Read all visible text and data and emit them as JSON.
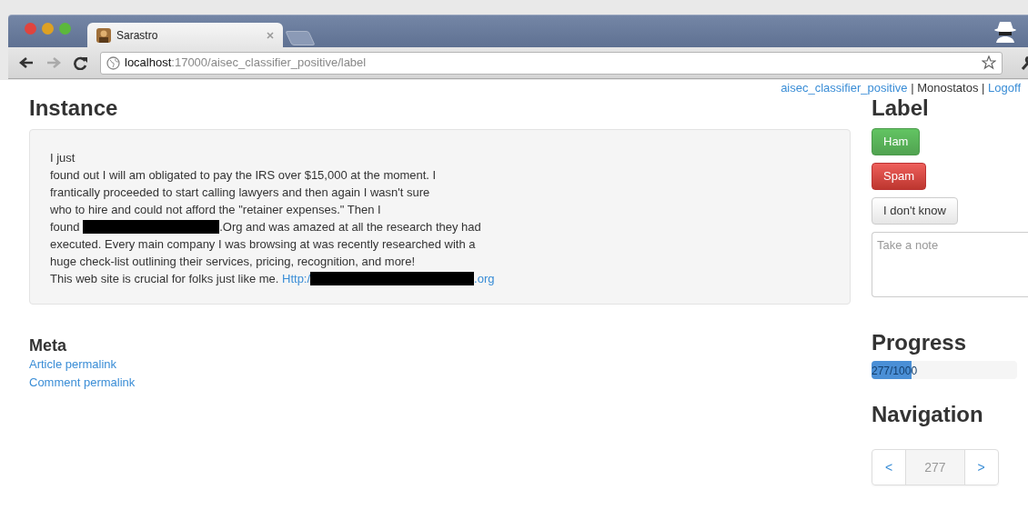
{
  "browser": {
    "tab": {
      "title": "Sarastro",
      "selected": true
    },
    "url": {
      "host": "localhost",
      "rest": ":17000/aisec_classifier_positive/label"
    }
  },
  "user_bar": [
    {
      "kind": "link",
      "text": "aisec_classifier_positive"
    },
    {
      "kind": "sep",
      "text": "|"
    },
    {
      "kind": "text",
      "text": "Monostatos"
    },
    {
      "kind": "sep",
      "text": "|"
    },
    {
      "kind": "link",
      "text": "Logoff"
    }
  ],
  "instance": {
    "heading": "Instance",
    "lines": [
      [
        {
          "kind": "text",
          "text": "I just"
        }
      ],
      [
        {
          "kind": "text",
          "text": "found out I will am obligated to pay the IRS over $15,000 at the moment. I"
        }
      ],
      [
        {
          "kind": "text",
          "text": "frantically proceeded to start calling lawyers and then again I wasn't sure"
        }
      ],
      [
        {
          "kind": "text",
          "text": "who to hire and could not afford the \"retainer expenses.\" Then I"
        }
      ],
      [
        {
          "kind": "text",
          "text": "found "
        },
        {
          "kind": "redacted"
        },
        {
          "kind": "text",
          "text": ".Org and was amazed at all the research they had"
        }
      ],
      [
        {
          "kind": "text",
          "text": "executed. Every main company I was browsing at was recently researched with a"
        }
      ],
      [
        {
          "kind": "text",
          "text": "huge check-list outlining their services, pricing, recognition, and more!"
        }
      ],
      [
        {
          "kind": "text",
          "text": "This web site is crucial for folks just like me. "
        },
        {
          "kind": "link",
          "text": "Http:/"
        },
        {
          "kind": "redacted-link"
        },
        {
          "kind": "link",
          "text": ".org"
        }
      ]
    ]
  },
  "meta": {
    "heading": "Meta",
    "links": [
      "Article permalink",
      "Comment permalink"
    ]
  },
  "label": {
    "heading": "Label",
    "buttons": [
      {
        "kind": "success",
        "text": "Ham"
      },
      {
        "kind": "danger",
        "text": "Spam"
      },
      {
        "kind": "default",
        "text": "I don't know"
      }
    ],
    "note": {
      "placeholder": "Take a note"
    }
  },
  "progress": {
    "heading": "Progress",
    "text": "277/1000",
    "level": 0.277
  },
  "navigation": {
    "heading": "Navigation",
    "prev": "<",
    "page": "277",
    "next": ">"
  }
}
